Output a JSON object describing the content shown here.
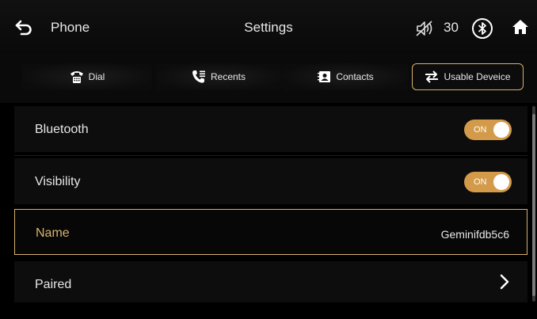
{
  "header": {
    "back_icon": "back-arrow-icon",
    "app_label": "Phone",
    "title": "Settings",
    "mute_icon": "speaker-muted-icon",
    "volume": "30",
    "bluetooth_icon": "bluetooth-icon",
    "home_icon": "home-icon"
  },
  "tabs": [
    {
      "label": "Dial",
      "icon": "dialpad-phone-icon",
      "active": false
    },
    {
      "label": "Recents",
      "icon": "recent-calls-icon",
      "active": false
    },
    {
      "label": "Contacts",
      "icon": "contacts-icon",
      "active": false
    },
    {
      "label": "Usable Deveice",
      "icon": "swap-arrows-icon",
      "active": true
    }
  ],
  "settings": {
    "bluetooth": {
      "label": "Bluetooth",
      "toggle": "ON",
      "enabled": true
    },
    "visibility": {
      "label": "Visibility",
      "toggle": "ON",
      "enabled": true
    },
    "name": {
      "label": "Name",
      "value": "Geminifdb5c6",
      "selected": true
    },
    "paired": {
      "label": "Paired",
      "icon": "chevron-right-icon"
    }
  },
  "colors": {
    "accent": "#d8b06a",
    "toggle_on": "#d39a4a",
    "background": "#000000",
    "row_background": "#0d0d0d"
  }
}
